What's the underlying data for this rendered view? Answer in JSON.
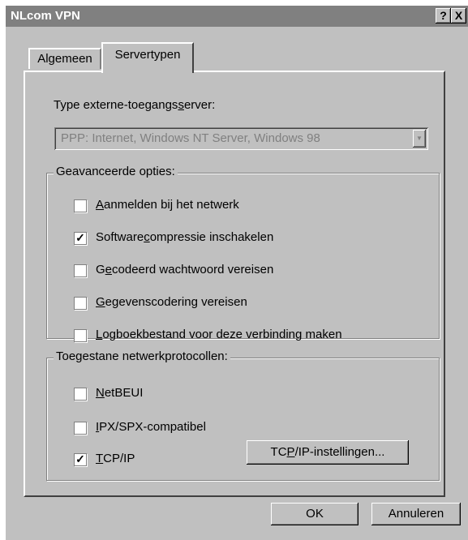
{
  "window": {
    "title": "NLcom VPN",
    "help_glyph": "?",
    "close_glyph": "X"
  },
  "tabs": [
    {
      "label": "Algemeen"
    },
    {
      "label": "Servertypen"
    }
  ],
  "server": {
    "label_pre": "Type externe-toegangs",
    "label_acc": "s",
    "label_post": "erver:",
    "value": "PPP: Internet, Windows NT Server, Windows 98"
  },
  "advanced": {
    "title": "Geavanceerde opties:",
    "items": [
      {
        "pre": "",
        "acc": "A",
        "post": "anmelden bij het netwerk",
        "checked": false
      },
      {
        "pre": "Software",
        "acc": "c",
        "post": "ompressie inschakelen",
        "checked": true
      },
      {
        "pre": "G",
        "acc": "e",
        "post": "codeerd wachtwoord vereisen",
        "checked": false
      },
      {
        "pre": "",
        "acc": "G",
        "post": "egevenscodering vereisen",
        "checked": false
      },
      {
        "pre": "",
        "acc": "L",
        "post": "ogboekbestand voor deze verbinding maken",
        "checked": false
      }
    ]
  },
  "protocols": {
    "title": "Toegestane netwerkprotocollen:",
    "items": [
      {
        "pre": "",
        "acc": "N",
        "post": "etBEUI",
        "checked": false
      },
      {
        "pre": "",
        "acc": "I",
        "post": "PX/SPX-compatibel",
        "checked": false
      },
      {
        "pre": "",
        "acc": "T",
        "post": "CP/IP",
        "checked": true
      }
    ],
    "settings_button": {
      "pre": "TC",
      "acc": "P",
      "post": "/IP-instellingen..."
    }
  },
  "buttons": {
    "ok": "OK",
    "cancel": "Annuleren"
  },
  "check_glyph": "✓"
}
